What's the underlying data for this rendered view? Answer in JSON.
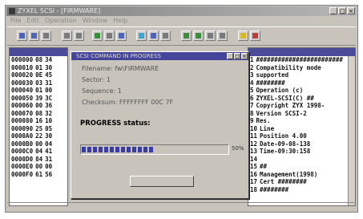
{
  "window": {
    "title": "ZYXEL SCSI - [FIRMWARE]"
  },
  "menu": [
    "File",
    "Edit",
    "Operation",
    "Window",
    "Help"
  ],
  "left_panel": {
    "rows": [
      {
        "a": "000000",
        "b": "08",
        "c": "34"
      },
      {
        "a": "000010",
        "b": "01",
        "c": "30"
      },
      {
        "a": "000020",
        "b": "0E",
        "c": "45"
      },
      {
        "a": "000030",
        "b": "03",
        "c": "31"
      },
      {
        "a": "000040",
        "b": "01",
        "c": "00"
      },
      {
        "a": "000050",
        "b": "39",
        "c": "3C"
      },
      {
        "a": "000060",
        "b": "00",
        "c": "36"
      },
      {
        "a": "000070",
        "b": "08",
        "c": "32"
      },
      {
        "a": "000080",
        "b": "16",
        "c": "10"
      },
      {
        "a": "000090",
        "b": "25",
        "c": "05"
      },
      {
        "a": "0000A0",
        "b": "22",
        "c": "30"
      },
      {
        "a": "0000B0",
        "b": "00",
        "c": "04"
      },
      {
        "a": "0000C0",
        "b": "04",
        "c": "41"
      },
      {
        "a": "0000D0",
        "b": "84",
        "c": "31"
      },
      {
        "a": "0000E0",
        "b": "00",
        "c": "00"
      },
      {
        "a": "0000F0",
        "b": "61",
        "c": "56"
      }
    ]
  },
  "right_panel": {
    "rows": [
      {
        "n": "1",
        "t": "########################"
      },
      {
        "n": "2",
        "t": "Compatibility mode"
      },
      {
        "n": "3",
        "t": "supported"
      },
      {
        "n": "4",
        "t": "########"
      },
      {
        "n": "5",
        "t": "Operation (c)"
      },
      {
        "n": "6",
        "t": "ZYXEL-SCSI(C) ##"
      },
      {
        "n": "7",
        "t": "Copyright ZYX 1998-"
      },
      {
        "n": "8",
        "t": "Version SCSI-2"
      },
      {
        "n": "9",
        "t": "Res."
      },
      {
        "n": "10",
        "t": "Line"
      },
      {
        "n": "11",
        "t": "Position 4.00"
      },
      {
        "n": "12",
        "t": "Date-09-08-138"
      },
      {
        "n": "13",
        "t": "Time-09:30:158"
      },
      {
        "n": "14",
        "t": ""
      },
      {
        "n": "15",
        "t": "##"
      },
      {
        "n": "16",
        "t": "Management(1998)"
      },
      {
        "n": "17",
        "t": "Cert    ########"
      },
      {
        "n": "18",
        "t": "        ########"
      }
    ]
  },
  "dialog": {
    "title": "SCSI COMMAND IN PROGRESS",
    "filename": "Filename: fw\\FIRMWARE",
    "sector": "Sector: 1",
    "sequence": "Sequence: 1",
    "checksum": "Checksum: FFFFFFFF 00C 7F",
    "status_label": "PROGRESS status:",
    "progress": 0.5,
    "percent": "50%",
    "button_label": ""
  },
  "colors": {
    "titlebar": "#44449a",
    "progress": "#3a3aa8"
  }
}
